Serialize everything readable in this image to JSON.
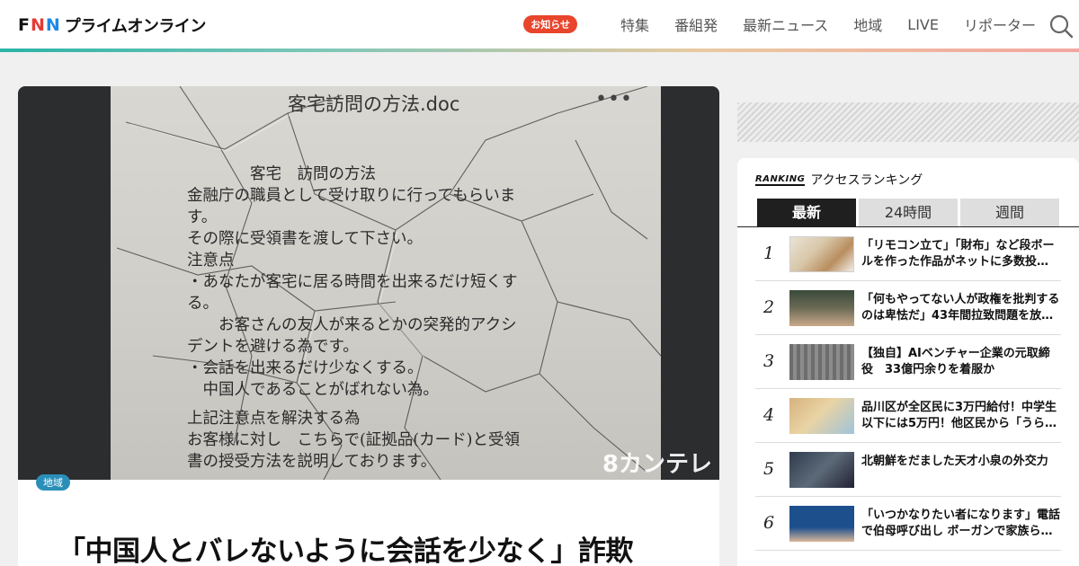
{
  "header": {
    "logo_fnn": [
      "F",
      "N",
      "N"
    ],
    "logo_text": "プライムオンライン",
    "notice_label": "お知らせ",
    "nav": [
      "特集",
      "番組発",
      "最新ニュース",
      "地域",
      "LIVE",
      "リポーター"
    ]
  },
  "article": {
    "image": {
      "doc_title": "客宅訪問の方法.doc",
      "doc_menu": "•••",
      "doc_lines": [
        "　　　　客宅　訪問の方法",
        "金融庁の職員として受け取りに行ってもらいま",
        "す。",
        "その際に受領書を渡して下さい。",
        "注意点",
        "・あなたが客宅に居る時間を出来るだけ短くす",
        "る。",
        "　　お客さんの友人が来るとかの突発的アクシ",
        "デントを避ける為です。",
        "・会話を出来るだけ少なくする。",
        "　中国人であることがばれない為。",
        "",
        "上記注意点を解決する為",
        "お客様に対し　こちらで(証拠品(カード)と受領",
        "書の授受方法を説明しております。"
      ],
      "watermark": "8カンテレ"
    },
    "category_tag": "地域",
    "headline": "「中国人とバレないように会話を少なく」詐欺"
  },
  "ranking": {
    "logo": "RANKING",
    "title": "アクセスランキング",
    "tabs": [
      "最新",
      "24時間",
      "週間"
    ],
    "active_tab": "最新",
    "items": [
      {
        "rank": "1",
        "text": "「リモコン立て」「財布」など段ボールを作った作品がネットに多数投…"
      },
      {
        "rank": "2",
        "text": "「何もやってない人が政権を批判するのは卑怯だ」43年間拉致問題を放…"
      },
      {
        "rank": "3",
        "text": "【独自】AIベンチャー企業の元取締役　33億円余りを着服か"
      },
      {
        "rank": "4",
        "text": "品川区が全区民に3万円給付！中学生以下には5万円！他区民から「うら…"
      },
      {
        "rank": "5",
        "text": "北朝鮮をだました天才小泉の外交力"
      },
      {
        "rank": "6",
        "text": "「いつかなりたい者になります」電話で伯母呼び出し ボーガンで家族ら…"
      }
    ]
  }
}
